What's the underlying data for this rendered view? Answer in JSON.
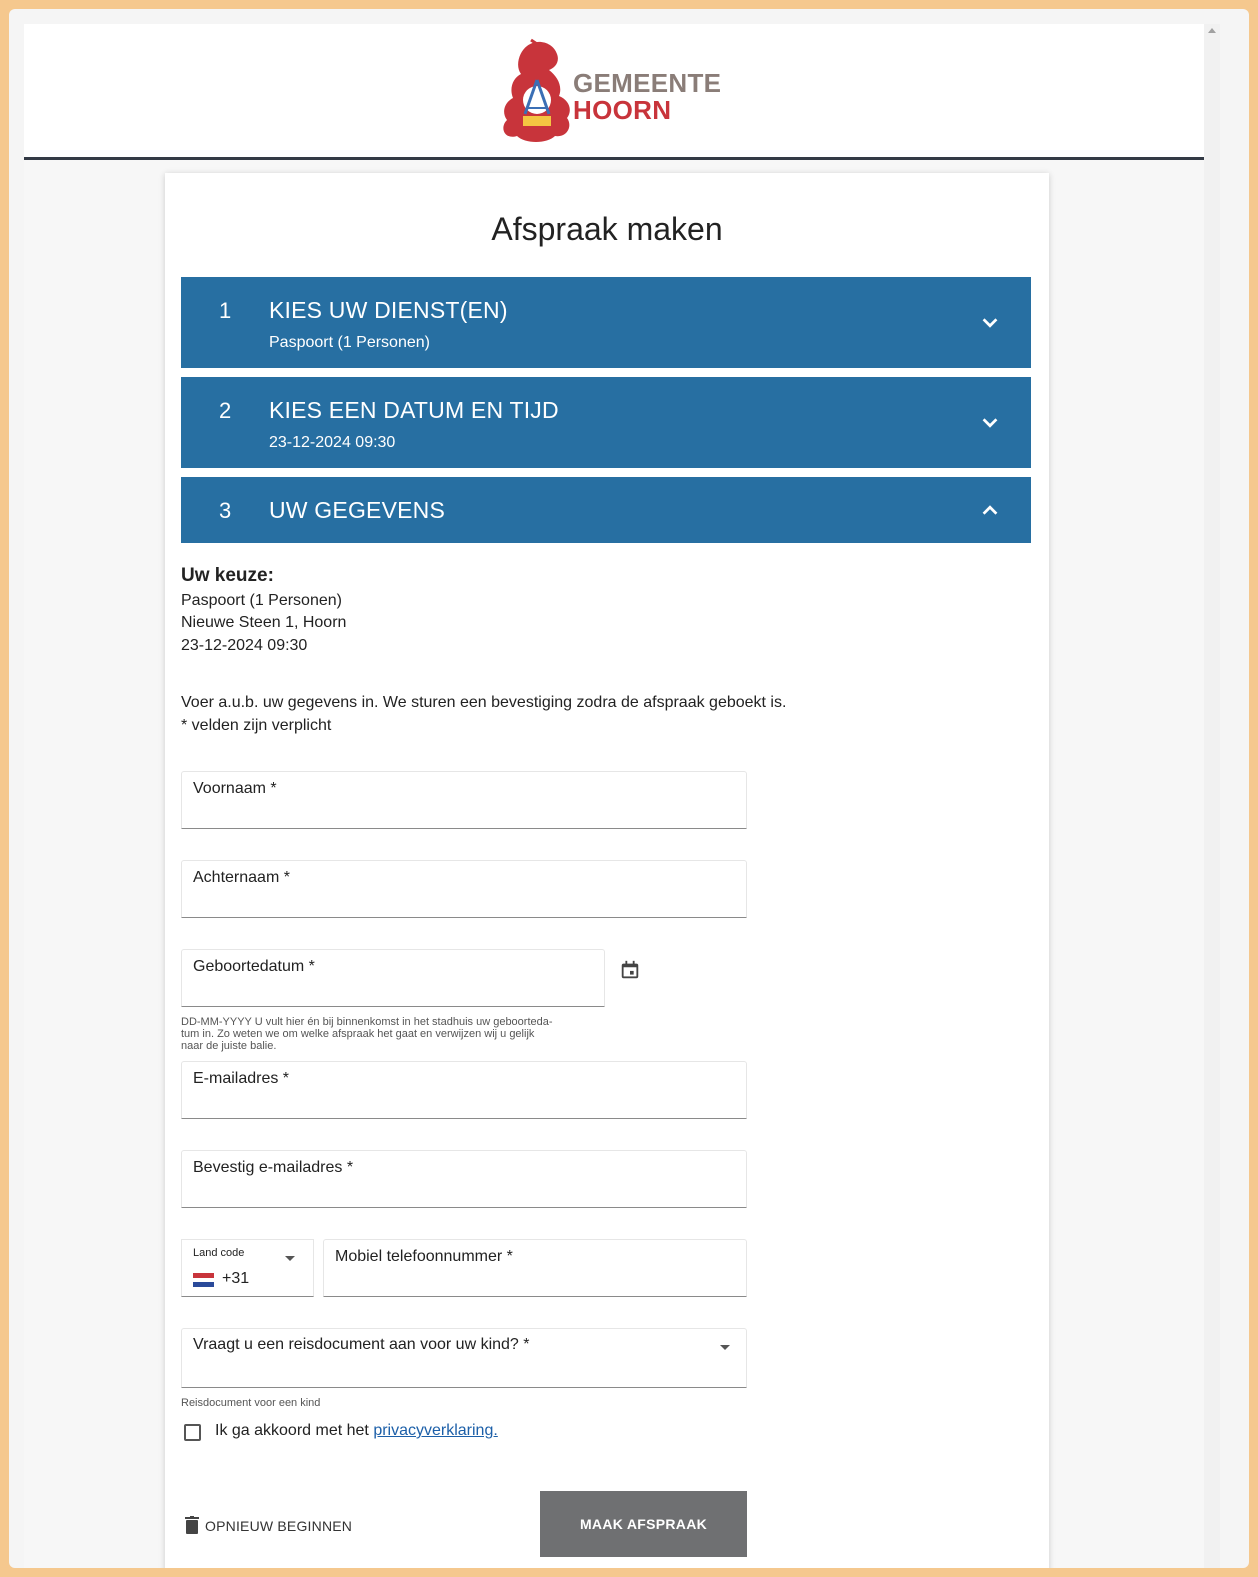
{
  "header": {
    "logo_line1": "GEMEENTE",
    "logo_line2": "HOORN"
  },
  "page": {
    "title": "Afspraak maken"
  },
  "steps": [
    {
      "number": "1",
      "title": "KIES UW DIENST(EN)",
      "subtitle": "Paspoort (1 Personen)",
      "state": "collapsed"
    },
    {
      "number": "2",
      "title": "KIES EEN DATUM EN TIJD",
      "subtitle": "23-12-2024 09:30",
      "state": "collapsed"
    },
    {
      "number": "3",
      "title": "UW GEGEVENS",
      "subtitle": "",
      "state": "expanded"
    }
  ],
  "choice": {
    "heading": "Uw keuze:",
    "service": "Paspoort (1 Personen)",
    "location": "Nieuwe Steen 1, Hoorn",
    "datetime": "23-12-2024 09:30"
  },
  "intro": {
    "line1": "Voer a.u.b. uw gegevens in. We sturen een bevestiging zodra de afspraak geboekt is.",
    "line2": "* velden zijn verplicht"
  },
  "form": {
    "firstname_label": "Voornaam *",
    "lastname_label": "Achternaam *",
    "birthdate_label": "Geboortedatum *",
    "birthdate_hint_1": "DD-MM-YYYY U vult hier én bij binnenkomst in het stadhuis uw geboorteda-",
    "birthdate_hint_2": "tum in. Zo weten we om welke afspraak het gaat en verwijzen wij u gelijk",
    "birthdate_hint_3": "naar de juiste balie.",
    "email_label": "E-mailadres *",
    "email_confirm_label": "Bevestig e-mailadres *",
    "landcode_label": "Land code",
    "landcode_value": "+31",
    "phone_label": "Mobiel telefoonnummer *",
    "child_doc_label": "Vraagt u een reisdocument aan voor uw kind? *",
    "child_doc_hint": "Reisdocument voor een kind",
    "consent_text": "Ik ga akkoord met het ",
    "consent_link": "privacyverklaring."
  },
  "actions": {
    "reset_label": "OPNIEUW BEGINNEN",
    "submit_label": "MAAK AFSPRAAK"
  },
  "icons": {
    "calendar": "calendar-icon",
    "trash": "trash-icon",
    "chevron_down": "chevron-down-icon",
    "chevron_up": "chevron-up-icon",
    "flag": "netherlands-flag-icon"
  },
  "colors": {
    "accent": "#276fa2",
    "submit_bg": "#6f7072",
    "page_border": "#f5c88e",
    "logo_red": "#c8343b",
    "logo_gray": "#8a7d78",
    "link": "#1c5fa8"
  }
}
